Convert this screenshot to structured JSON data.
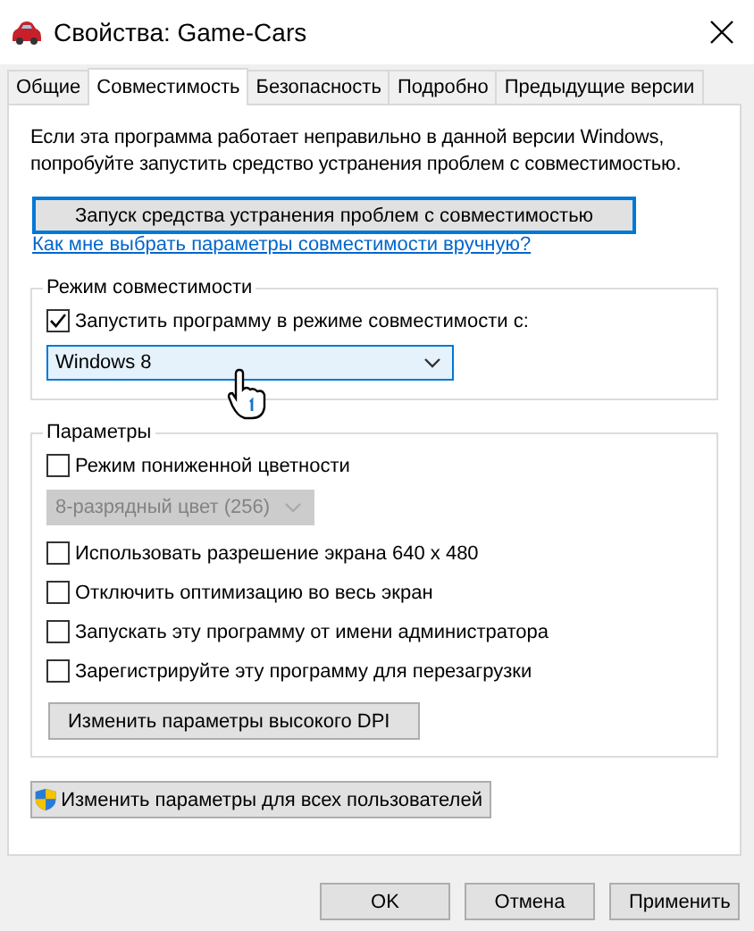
{
  "window": {
    "title": "Свойства: Game-Cars"
  },
  "tabs": [
    {
      "label": "Общие",
      "selected": false
    },
    {
      "label": "Совместимость",
      "selected": true
    },
    {
      "label": "Безопасность",
      "selected": false
    },
    {
      "label": "Подробно",
      "selected": false
    },
    {
      "label": "Предыдущие версии",
      "selected": false
    }
  ],
  "intro": [
    "Если эта программа работает неправильно в данной версии Windows,",
    "попробуйте запустить средство устранения проблем с совместимостью."
  ],
  "troubleshoot_button": "Запуск средства устранения проблем с совместимостью",
  "help_link": "Как мне выбрать параметры совместимости вручную?",
  "compat_group": {
    "title": "Режим совместимости",
    "checkbox": {
      "label": "Запустить программу в режиме совместимости с:",
      "checked": true
    },
    "dropdown": {
      "value": "Windows 8"
    }
  },
  "settings_group": {
    "title": "Параметры",
    "items": [
      {
        "kind": "checkbox",
        "label": "Режим пониженной цветности",
        "checked": false
      },
      {
        "kind": "dropdown",
        "value": "8-разрядный цвет (256)",
        "disabled": true
      },
      {
        "kind": "checkbox",
        "label": "Использовать разрешение экрана 640 x 480",
        "checked": false
      },
      {
        "kind": "checkbox",
        "label": "Отключить оптимизацию во весь экран",
        "checked": false
      },
      {
        "kind": "checkbox",
        "label": "Запускать эту программу от имени администратора",
        "checked": false
      },
      {
        "kind": "checkbox",
        "label": "Зарегистрируйте эту программу для перезагрузки",
        "checked": false
      },
      {
        "kind": "button",
        "label": "Изменить параметры высокого DPI"
      }
    ]
  },
  "all_users_button": "Изменить параметры для всех пользователей",
  "buttons": [
    "OK",
    "Отмена",
    "Применить"
  ]
}
